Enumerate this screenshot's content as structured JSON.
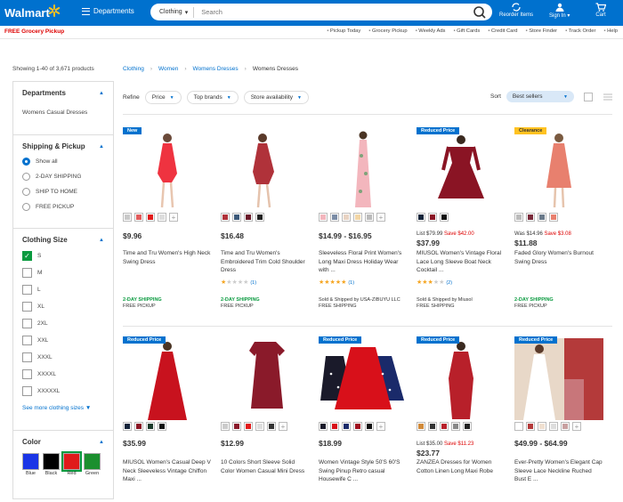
{
  "header": {
    "logo": "Walmart",
    "departments": "Departments",
    "search_category": "Clothing",
    "search_placeholder": "Search",
    "reorder": "Reorder Items",
    "signin": "Sign In",
    "cart": "Cart",
    "brand_color": "#0071ce"
  },
  "subbar": {
    "free_grocery": "FREE Grocery Pickup",
    "links": [
      "Pickup Today",
      "Grocery Pickup",
      "Weekly Ads",
      "Gift Cards",
      "Credit Card",
      "Store Finder",
      "Track Order",
      "Help"
    ]
  },
  "results": {
    "showing": "Showing 1-40 of 3,671 products"
  },
  "breadcrumb": [
    "Clothing",
    "Women",
    "Womens Dresses",
    "Womens Dresses"
  ],
  "refine": {
    "label": "Refine",
    "pills": [
      "Price",
      "Top brands",
      "Store availability"
    ],
    "sort_label": "Sort",
    "sort_value": "Best sellers"
  },
  "filters": {
    "departments": {
      "title": "Departments",
      "items": [
        "Womens Casual Dresses"
      ]
    },
    "shipping": {
      "title": "Shipping & Pickup",
      "items": [
        "Show all",
        "2-DAY SHIPPING",
        "SHIP TO HOME",
        "FREE PICKUP"
      ]
    },
    "size": {
      "title": "Clothing Size",
      "items": [
        "S",
        "M",
        "L",
        "XL",
        "2XL",
        "XXL",
        "XXXL",
        "XXXXL",
        "XXXXXL"
      ],
      "see_more": "See more clothing sizes"
    },
    "color": {
      "title": "Color",
      "items": [
        "Blue",
        "Black",
        "Red",
        "Green"
      ]
    }
  },
  "products": [
    {
      "badge": "New",
      "price": "$9.96",
      "title": "Time and Tru Women's High Neck Swing Dress",
      "ship1": "2-DAY SHIPPING",
      "ship2": "FREE PICKUP"
    },
    {
      "badge": "",
      "price": "$16.48",
      "title": "Time and Tru Women's Embroidered Trim Cold Shoulder Dress",
      "rating_count": "(1)",
      "ship1": "2-DAY SHIPPING",
      "ship2": "FREE PICKUP"
    },
    {
      "badge": "",
      "price": "$14.99 - $16.95",
      "title": "Sleeveless Floral Print Women's Long Maxi Dress Holiday Wear with ...",
      "rating_count": "(1)",
      "ship1": "Sold & Shipped by USA-ZIBUYU LLC",
      "ship2": "FREE SHIPPING"
    },
    {
      "badge": "Reduced Price",
      "list": "List $79.99",
      "save": "Save $42.00",
      "price": "$37.99",
      "title": "MIUSOL Women's Vintage Floral Lace Long Sleeve Boat Neck Cocktail ...",
      "rating_count": "(2)",
      "ship1": "Sold & Shipped by Miusol",
      "ship2": "FREE SHIPPING"
    },
    {
      "badge": "Clearance",
      "list": "Was $14.96",
      "save": "Save $3.08",
      "price": "$11.88",
      "title": "Faded Glory Women's Burnout Swing Dress",
      "ship1": "2-DAY SHIPPING",
      "ship2": "FREE PICKUP"
    },
    {
      "badge": "Reduced Price",
      "price": "$35.99",
      "title": "MIUSOL Women's Casual Deep V Neck Sleeveless Vintage Chiffon Maxi ..."
    },
    {
      "badge": "",
      "price": "$12.99",
      "title": "10 Colors Short Sleeve Solid Color Women Casual Mini Dress"
    },
    {
      "badge": "Reduced Price",
      "price": "$18.99",
      "title": "Women Vintage Style 50'S 60'S Swing Pinup Retro casual Housewife C ..."
    },
    {
      "badge": "Reduced Price",
      "list": "List $35.00",
      "save": "Save $11.23",
      "price": "$23.77",
      "title": "ZANZEA Dresses for Women Cotton Linen Long Maxi Robe"
    },
    {
      "badge": "Reduced Price",
      "price": "$49.99 - $64.99",
      "title": "Ever-Pretty Women's Elegant Cap Sleeve Lace Neckline Ruched Bust E ..."
    }
  ]
}
